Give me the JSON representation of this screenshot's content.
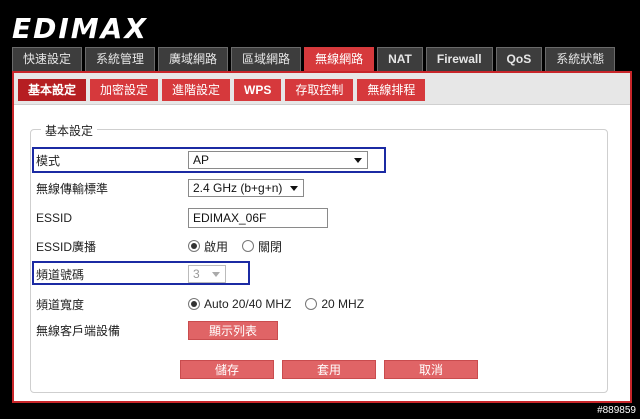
{
  "brand": {
    "logo": "EDIMAX"
  },
  "main_tabs": [
    {
      "label": "快速設定",
      "active": false
    },
    {
      "label": "系統管理",
      "active": false
    },
    {
      "label": "廣域網路",
      "active": false
    },
    {
      "label": "區域網路",
      "active": false
    },
    {
      "label": "無線網路",
      "active": true
    },
    {
      "label": "NAT",
      "active": false
    },
    {
      "label": "Firewall",
      "active": false
    },
    {
      "label": "QoS",
      "active": false
    },
    {
      "label": "系統狀態",
      "active": false
    }
  ],
  "sub_tabs": [
    {
      "label": "基本設定",
      "active": true
    },
    {
      "label": "加密設定",
      "active": false
    },
    {
      "label": "進階設定",
      "active": false
    },
    {
      "label": "WPS",
      "active": false
    },
    {
      "label": "存取控制",
      "active": false
    },
    {
      "label": "無線排程",
      "active": false
    }
  ],
  "form": {
    "legend": "基本設定",
    "mode": {
      "label": "模式",
      "value": "AP"
    },
    "band": {
      "label": "無線傳輸標準",
      "value": "2.4 GHz (b+g+n)"
    },
    "essid": {
      "label": "ESSID",
      "value": "EDIMAX_06F"
    },
    "broadcast": {
      "label": "ESSID廣播",
      "opt_on": "啟用",
      "opt_off": "關閉",
      "selected": "on"
    },
    "channel": {
      "label": "頻道號碼",
      "value": "3"
    },
    "width": {
      "label": "頻道寬度",
      "opt_auto": "Auto 20/40 MHZ",
      "opt_20": "20 MHZ",
      "selected": "auto"
    },
    "clients": {
      "label": "無線客戶端設備",
      "button": "顯示列表"
    }
  },
  "actions": {
    "save": "儲存",
    "apply": "套用",
    "cancel": "取消"
  },
  "watermark": "#889859",
  "colors": {
    "accent_red": "#d6393c",
    "highlight_blue": "#1b2aa3"
  }
}
